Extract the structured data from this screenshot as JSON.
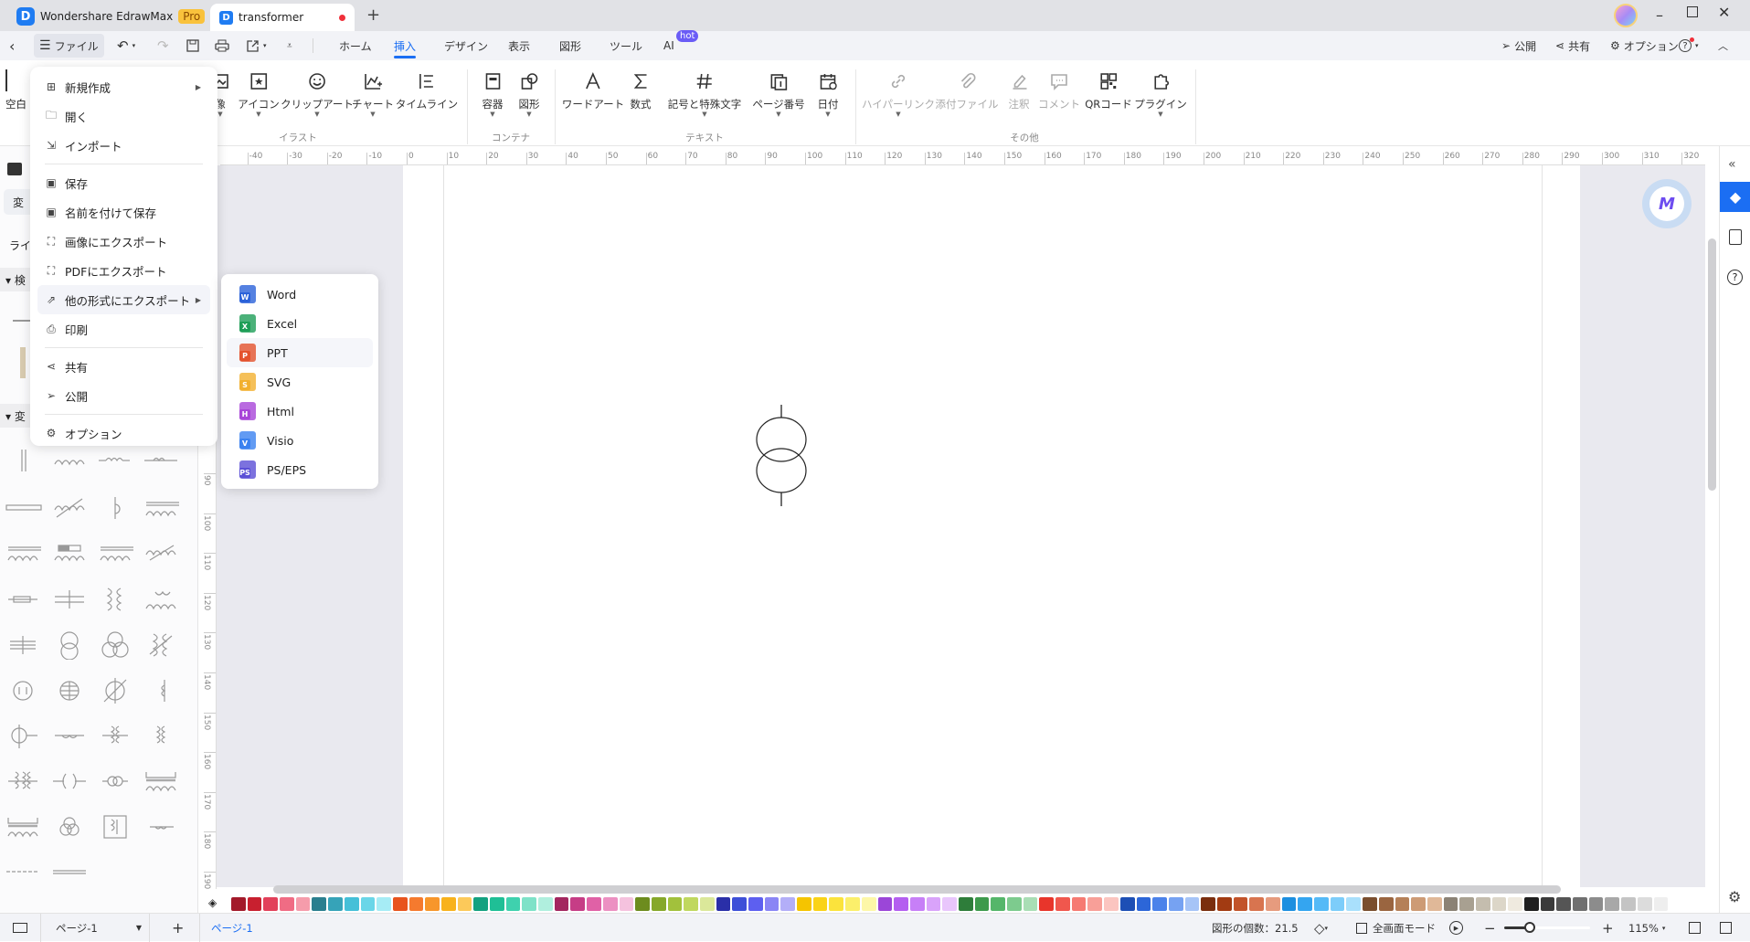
{
  "app": {
    "name": "Wondershare EdrawMax",
    "badge": "Pro"
  },
  "document_tab": {
    "title": "transformer",
    "unsaved": true,
    "new_tab": "+"
  },
  "menubar": {
    "file": "ファイル",
    "tabs": [
      "ホーム",
      "挿入",
      "デザイン",
      "表示",
      "図形",
      "ツール",
      "AI"
    ],
    "active_tab": "挿入",
    "ai_badge": "hot",
    "publish": "公開",
    "share": "共有",
    "options": "オプション"
  },
  "ribbon": {
    "partial_left": "空白",
    "items": [
      {
        "label": "像",
        "icon": "image-icon",
        "dropdown": true,
        "disabled": false
      },
      {
        "label": "アイコン",
        "icon": "icon-icon",
        "dropdown": true,
        "disabled": false
      },
      {
        "label": "クリップアート",
        "icon": "clipart-icon",
        "dropdown": true,
        "disabled": false
      },
      {
        "label": "チャート",
        "icon": "chart-icon",
        "dropdown": true,
        "disabled": false
      },
      {
        "label": "タイムライン",
        "icon": "timeline-icon",
        "dropdown": false,
        "disabled": false
      },
      {
        "label": "容器",
        "icon": "container-icon",
        "dropdown": true,
        "disabled": false
      },
      {
        "label": "図形",
        "icon": "shape-icon",
        "dropdown": true,
        "disabled": false
      },
      {
        "label": "ワードアート",
        "icon": "wordart-icon",
        "dropdown": false,
        "disabled": false
      },
      {
        "label": "数式",
        "icon": "formula-icon",
        "dropdown": false,
        "disabled": false
      },
      {
        "label": "記号と特殊文字",
        "icon": "symbol-icon",
        "dropdown": true,
        "disabled": false
      },
      {
        "label": "ページ番号",
        "icon": "page-number-icon",
        "dropdown": true,
        "disabled": false
      },
      {
        "label": "日付",
        "icon": "date-icon",
        "dropdown": true,
        "disabled": false
      },
      {
        "label": "ハイパーリンク",
        "icon": "hyperlink-icon",
        "dropdown": true,
        "disabled": true
      },
      {
        "label": "添付ファイル",
        "icon": "attachment-icon",
        "dropdown": false,
        "disabled": true
      },
      {
        "label": "注釈",
        "icon": "annotation-icon",
        "dropdown": false,
        "disabled": true
      },
      {
        "label": "コメント",
        "icon": "comment-icon",
        "dropdown": false,
        "disabled": true
      },
      {
        "label": "QRコード",
        "icon": "qr-code-icon",
        "dropdown": false,
        "disabled": false
      },
      {
        "label": "プラグイン",
        "icon": "plugin-icon",
        "dropdown": true,
        "disabled": false
      }
    ],
    "groups": [
      "イラスト",
      "コンテナ",
      "テキスト",
      "その他"
    ]
  },
  "file_menu": {
    "items": [
      {
        "label": "新規作成",
        "icon": "new-icon",
        "submenu": true
      },
      {
        "label": "開く",
        "icon": "folder-icon"
      },
      {
        "label": "インポート",
        "icon": "import-icon",
        "sep_after": true
      },
      {
        "label": "保存",
        "icon": "save-icon"
      },
      {
        "label": "名前を付けて保存",
        "icon": "save-as-icon"
      },
      {
        "label": "画像にエクスポート",
        "icon": "export-image-icon"
      },
      {
        "label": "PDFにエクスポート",
        "icon": "export-pdf-icon"
      },
      {
        "label": "他の形式にエクスポート",
        "icon": "export-other-icon",
        "submenu": true,
        "highlighted": true
      },
      {
        "label": "印刷",
        "icon": "print-icon",
        "sep_after": true
      },
      {
        "label": "共有",
        "icon": "share-icon"
      },
      {
        "label": "公開",
        "icon": "publish-icon",
        "sep_after": true
      },
      {
        "label": "オプション",
        "icon": "gear-icon"
      }
    ]
  },
  "export_submenu": {
    "items": [
      {
        "label": "Word",
        "letter": "W",
        "color": "#2b62d9"
      },
      {
        "label": "Excel",
        "letter": "X",
        "color": "#1e9e57"
      },
      {
        "label": "PPT",
        "letter": "P",
        "color": "#e4522d",
        "hovered": true
      },
      {
        "label": "SVG",
        "letter": "S",
        "color": "#f2b02f"
      },
      {
        "label": "Html",
        "letter": "H",
        "color": "#a845d8"
      },
      {
        "label": "Visio",
        "letter": "V",
        "color": "#3b82f0"
      },
      {
        "label": "PS/EPS",
        "letter": "PS",
        "color": "#5b4fd6"
      }
    ]
  },
  "sidebar": {
    "tab_partial": "変",
    "row_partial": "ライ",
    "section1_partial": "検",
    "section2_partial": "変",
    "shapes": [
      "parallel-lines",
      "coil-wide",
      "coil-small",
      "coil-line",
      "bar",
      "variable-coil",
      "hook",
      "core-coil",
      "core-coil",
      "slider-coil",
      "core-coil",
      "adjust-coil",
      "small-coil",
      "cross-coil",
      "transformer-vertical",
      "double-coil",
      "cross-lines",
      "two-circles",
      "three-circles",
      "variable-transformer",
      "circle-coil",
      "circle-grid",
      "circle-arrow",
      "half-coil",
      "circle-tap",
      "wave",
      "triple-coil",
      "double-coil-v",
      "multi-coil",
      "facing-coils",
      "ring-pair",
      "core-coil-double",
      "core-coil-double",
      "three-circles-small",
      "boxed-coil",
      "small-wave",
      "dashed-line",
      "double-line"
    ]
  },
  "ruler": {
    "h": [
      -40,
      -30,
      -20,
      -10,
      0,
      10,
      20,
      30,
      40,
      50,
      60,
      70,
      80,
      90,
      100,
      110,
      120,
      130,
      140,
      150,
      160,
      170,
      180,
      190,
      200,
      210,
      220,
      230,
      240,
      250,
      260,
      270,
      280,
      290,
      300,
      310,
      320
    ],
    "v": [
      90,
      100,
      110,
      120,
      130,
      140,
      150,
      160,
      170,
      180,
      190
    ]
  },
  "palette": [
    "#a31a2a",
    "#c8202f",
    "#e2405a",
    "#f06c84",
    "#f59cab",
    "#2a7f8f",
    "#36a3b8",
    "#45c0d8",
    "#6ad6e8",
    "#a6ecf5",
    "#e8541e",
    "#f57a2e",
    "#f7962b",
    "#f8b21c",
    "#fcc95a",
    "#13a180",
    "#1fbf96",
    "#3fd1ae",
    "#7ee2c8",
    "#b0efde",
    "#a3265f",
    "#c63d86",
    "#e061a6",
    "#ec90c2",
    "#f5c2de",
    "#6d8c1e",
    "#86a82a",
    "#a2c13c",
    "#c0d85f",
    "#dbe89a",
    "#2a2fa8",
    "#3d4fd8",
    "#5d5ff0",
    "#8a85f5",
    "#b3aef8",
    "#f5c400",
    "#fad317",
    "#fbe33c",
    "#fbef6b",
    "#fdf7a8",
    "#9b46d8",
    "#b45ff0",
    "#c77ff7",
    "#d9a3fa",
    "#e9c6fc",
    "#2e7d3a",
    "#3d9a4c",
    "#55b66a",
    "#7dcb8e",
    "#a9deb5",
    "#e8352b",
    "#f0574d",
    "#f67a72",
    "#f89f98",
    "#fbc5c0",
    "#1d4fb5",
    "#2c66d8",
    "#4b82ea",
    "#76a2f2",
    "#a6c4f7",
    "#7a2e0e",
    "#a23b12",
    "#c2532a",
    "#d8744f",
    "#e69b7e",
    "#1c8fe0",
    "#34a5f0",
    "#55baf7",
    "#7dcdfa",
    "#a9e0fc",
    "#7a4e2e",
    "#9a6540",
    "#b58058",
    "#cd9b75",
    "#e0b898",
    "#8b8275",
    "#a8a091",
    "#c4bdae",
    "#dcd6c8",
    "#efeadf",
    "#1f1f1f",
    "#3a3a3a",
    "#555555",
    "#707070",
    "#8c8c8c",
    "#a8a8a8",
    "#c4c4c4",
    "#dcdcdc",
    "#eeeeee"
  ],
  "status": {
    "page_select": "ページ-1",
    "add_page": "+",
    "page_tab": "ページ-1",
    "shape_count": "図形の個数：21.5",
    "fullscreen": "全画面モード",
    "zoom_out": "−",
    "zoom_in": "+",
    "zoom": "115%",
    "zoom_level": 0.3
  },
  "colors": {
    "accent": "#1b6ef3"
  }
}
